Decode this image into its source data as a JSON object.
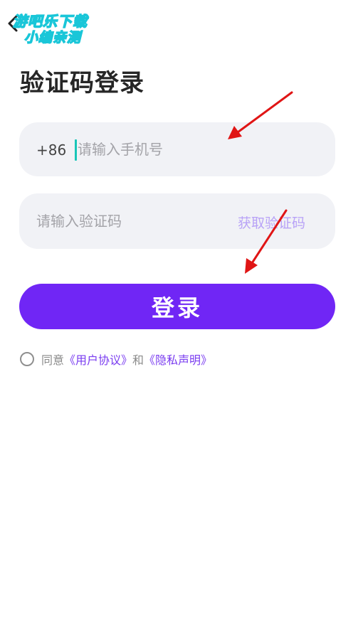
{
  "watermark": {
    "line1": "游吧乐下载",
    "line2": "小编亲测"
  },
  "page": {
    "title": "验证码登录"
  },
  "phone": {
    "prefix": "+86",
    "placeholder": "请输入手机号"
  },
  "code": {
    "placeholder": "请输入验证码",
    "get_code_label": "获取验证码"
  },
  "login": {
    "label": "登录"
  },
  "agreement": {
    "prefix": "同意",
    "user_agreement": "《用户协议》",
    "conjunction": "和",
    "privacy": "《隐私声明》"
  },
  "colors": {
    "accent": "#7026f5",
    "caret": "#19c6b8",
    "annotation_arrow": "#e01515"
  },
  "icons": {
    "back": "chevron-left-icon",
    "agree": "radio-unchecked-icon"
  }
}
